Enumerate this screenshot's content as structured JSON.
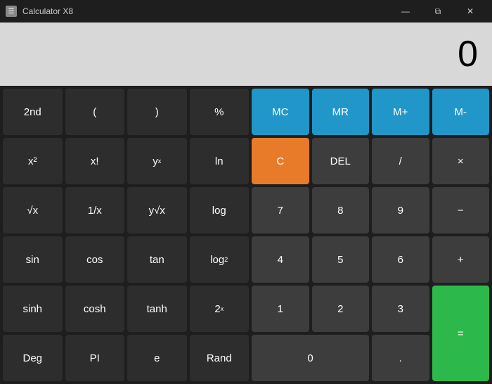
{
  "titleBar": {
    "icon": "☰",
    "title": "Calculator X8",
    "minimize": "—",
    "maximize": "□",
    "close": "✕",
    "restore": "⧉"
  },
  "display": {
    "value": "0"
  },
  "leftPanel": [
    {
      "label": "2nd",
      "type": "dark",
      "name": "second"
    },
    {
      "label": "(",
      "type": "dark",
      "name": "open-paren"
    },
    {
      "label": ")",
      "type": "dark",
      "name": "close-paren"
    },
    {
      "label": "%",
      "type": "dark",
      "name": "percent"
    },
    {
      "label": "x²",
      "type": "dark",
      "name": "x-squared"
    },
    {
      "label": "x!",
      "type": "dark",
      "name": "x-factorial"
    },
    {
      "label": "yˣ",
      "type": "dark",
      "name": "y-to-x"
    },
    {
      "label": "ln",
      "type": "dark",
      "name": "natural-log"
    },
    {
      "label": "√x",
      "type": "dark",
      "name": "sqrt"
    },
    {
      "label": "1/x",
      "type": "dark",
      "name": "reciprocal"
    },
    {
      "label": "y√x",
      "type": "dark",
      "name": "y-root-x"
    },
    {
      "label": "log",
      "type": "dark",
      "name": "log"
    },
    {
      "label": "sin",
      "type": "dark",
      "name": "sin"
    },
    {
      "label": "cos",
      "type": "dark",
      "name": "cos"
    },
    {
      "label": "tan",
      "type": "dark",
      "name": "tan"
    },
    {
      "label": "log₂",
      "type": "dark",
      "name": "log2"
    },
    {
      "label": "sinh",
      "type": "dark",
      "name": "sinh"
    },
    {
      "label": "cosh",
      "type": "dark",
      "name": "cosh"
    },
    {
      "label": "tanh",
      "type": "dark",
      "name": "tanh"
    },
    {
      "label": "2ˣ",
      "type": "dark",
      "name": "two-to-x"
    },
    {
      "label": "Deg",
      "type": "dark",
      "name": "degree"
    },
    {
      "label": "PI",
      "type": "dark",
      "name": "pi"
    },
    {
      "label": "e",
      "type": "dark",
      "name": "euler"
    },
    {
      "label": "Rand",
      "type": "dark",
      "name": "random"
    }
  ],
  "rightPanel": {
    "row1": [
      {
        "label": "MC",
        "type": "blue",
        "name": "memory-clear"
      },
      {
        "label": "MR",
        "type": "blue",
        "name": "memory-recall"
      },
      {
        "label": "M+",
        "type": "blue",
        "name": "memory-add"
      },
      {
        "label": "M-",
        "type": "blue",
        "name": "memory-subtract"
      }
    ],
    "row2": [
      {
        "label": "C",
        "type": "orange",
        "name": "clear"
      },
      {
        "label": "DEL",
        "type": "mid",
        "name": "delete"
      },
      {
        "label": "/",
        "type": "mid",
        "name": "divide"
      },
      {
        "label": "×",
        "type": "mid",
        "name": "multiply"
      }
    ],
    "row3": [
      {
        "label": "7",
        "type": "mid",
        "name": "seven"
      },
      {
        "label": "8",
        "type": "mid",
        "name": "eight"
      },
      {
        "label": "9",
        "type": "mid",
        "name": "nine"
      },
      {
        "label": "−",
        "type": "mid",
        "name": "subtract"
      }
    ],
    "row4": [
      {
        "label": "4",
        "type": "mid",
        "name": "four"
      },
      {
        "label": "5",
        "type": "mid",
        "name": "five"
      },
      {
        "label": "6",
        "type": "mid",
        "name": "six"
      },
      {
        "label": "+",
        "type": "mid",
        "name": "add"
      }
    ],
    "row5": [
      {
        "label": "1",
        "type": "mid",
        "name": "one"
      },
      {
        "label": "2",
        "type": "mid",
        "name": "two"
      },
      {
        "label": "3",
        "type": "mid",
        "name": "three"
      }
    ],
    "row6": [
      {
        "label": "0",
        "type": "mid",
        "name": "zero"
      },
      {
        "label": ".",
        "type": "mid",
        "name": "decimal"
      }
    ],
    "equals": {
      "label": "=",
      "type": "green",
      "name": "equals"
    }
  }
}
